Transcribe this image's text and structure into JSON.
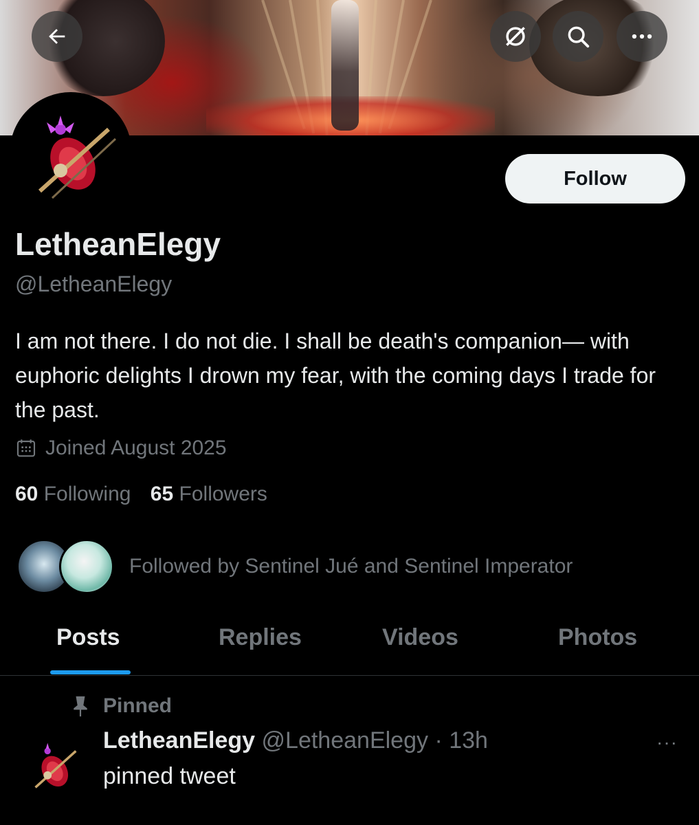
{
  "header": {
    "back_icon": "arrow-left-icon",
    "grok_icon": "grok-icon",
    "search_icon": "search-icon",
    "more_icon": "more-horizontal-icon"
  },
  "profile": {
    "display_name": "LetheanElegy",
    "handle": "@LetheanElegy",
    "follow_label": "Follow",
    "bio": "I am not there. I do not die. I shall be death's companion— with euphoric delights I drown my fear, with the coming days I trade for the past.",
    "joined": "Joined August 2025",
    "following_count": "60",
    "following_label": "Following",
    "followers_count": "65",
    "followers_label": "Followers",
    "followed_by": "Followed by Sentinel Jué and Sentinel Imperator"
  },
  "tabs": [
    {
      "label": "Posts",
      "active": true
    },
    {
      "label": "Replies",
      "active": false
    },
    {
      "label": "Videos",
      "active": false
    },
    {
      "label": "Photos",
      "active": false
    }
  ],
  "pinned_post": {
    "pinned_label": "Pinned",
    "author_name": "LetheanElegy",
    "author_handle_time": "@LetheanElegy · 13h",
    "text": "pinned tweet",
    "more": "···"
  },
  "colors": {
    "accent": "#1d9bf0",
    "muted": "#71767b",
    "text": "#e7e9ea"
  }
}
